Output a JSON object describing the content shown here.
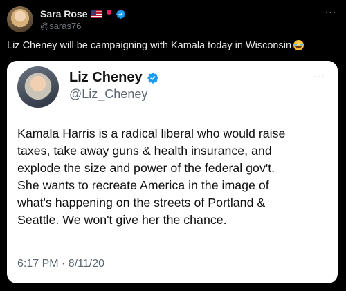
{
  "post": {
    "author_name": "Sara Rose",
    "author_handle": "@saras76",
    "more_label": "···",
    "text": "Liz Cheney will be campaigning with Kamala today in Wisconsin"
  },
  "embedded_tweet": {
    "author_name": "Liz Cheney",
    "author_handle": "@Liz_Cheney",
    "more_label": "···",
    "body_lines": [
      "Kamala Harris is a radical liberal who would raise",
      "taxes, take away guns & health insurance, and",
      "explode the size and power of the federal gov't.",
      "She wants to recreate America in the image of",
      "what's happening on the streets of Portland &",
      "Seattle. We won't give her the chance."
    ],
    "timestamp": "6:17 PM · 8/11/20"
  },
  "icons": {
    "flag": "us-flag-icon",
    "pin": "rose-pin-icon",
    "verified": "verified-badge-icon",
    "emoji": "tears-of-joy-emoji-icon"
  },
  "colors": {
    "background": "#000000",
    "verified_blue": "#1d9bf0",
    "text_primary": "#e7e9ea",
    "text_secondary": "#71767b"
  }
}
